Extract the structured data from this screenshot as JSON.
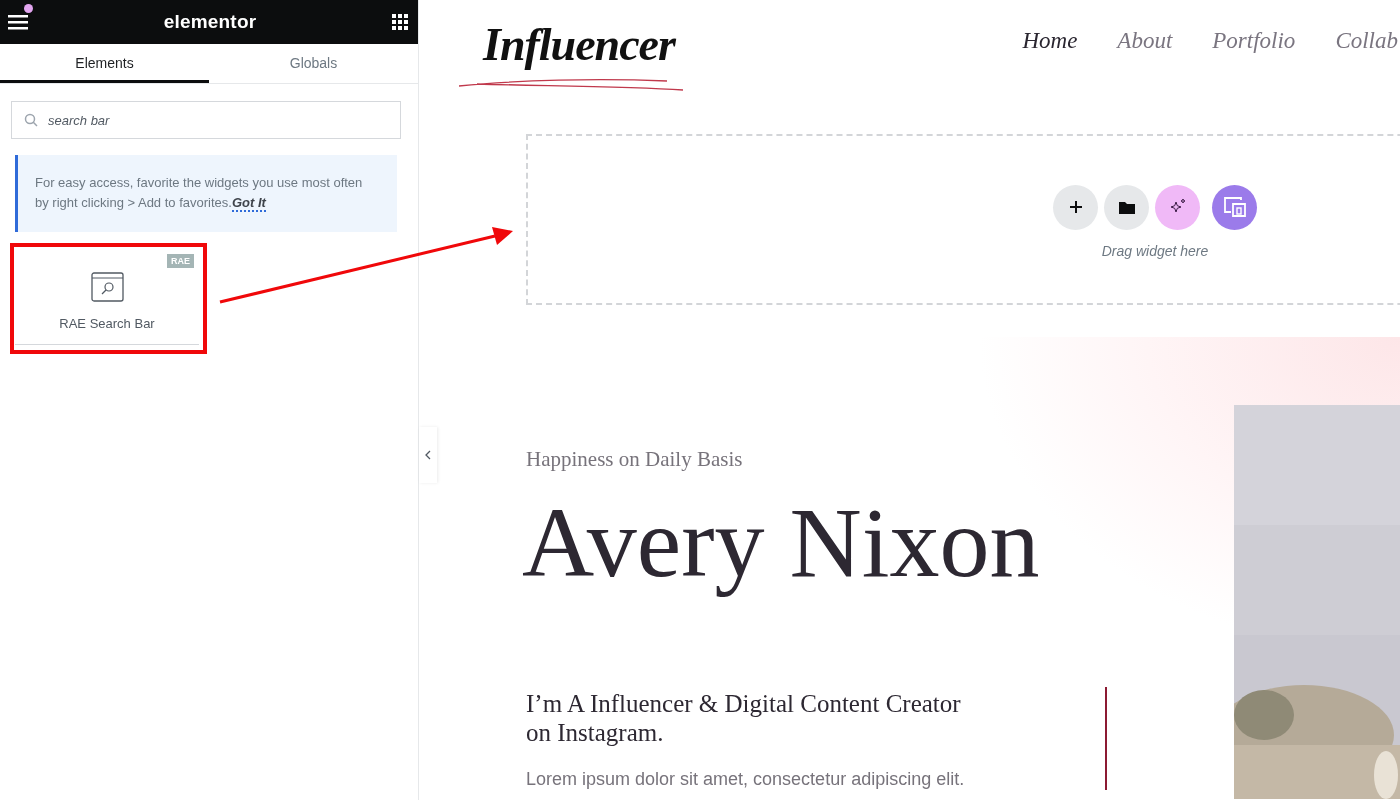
{
  "editor": {
    "logo": "elementor",
    "notification": true
  },
  "tabs": [
    {
      "label": "Elements",
      "selected": true
    },
    {
      "label": "Globals",
      "selected": false
    }
  ],
  "search": {
    "value": "search bar"
  },
  "tip": {
    "text": "For easy access, favorite the widgets you use most often by right clicking > Add to favorites.",
    "link": "Got It"
  },
  "widgets": [
    {
      "label": "RAE Search Bar",
      "badge": "RAE"
    }
  ],
  "site": {
    "logo": "Influencer",
    "nav": [
      {
        "label": "Home",
        "selected": true
      },
      {
        "label": "About",
        "selected": false
      },
      {
        "label": "Portfolio",
        "selected": false
      },
      {
        "label": "Collab",
        "selected": false
      }
    ],
    "drop_zone": {
      "hint": "Drag widget here"
    },
    "hero": {
      "eyebrow": "Happiness on Daily Basis",
      "title": "Avery Nixon",
      "subtitle": "I’m A Influencer & Digital Content Creator on Instagram.",
      "body": "Lorem ipsum dolor sit amet, consectetur adipiscing elit."
    }
  }
}
